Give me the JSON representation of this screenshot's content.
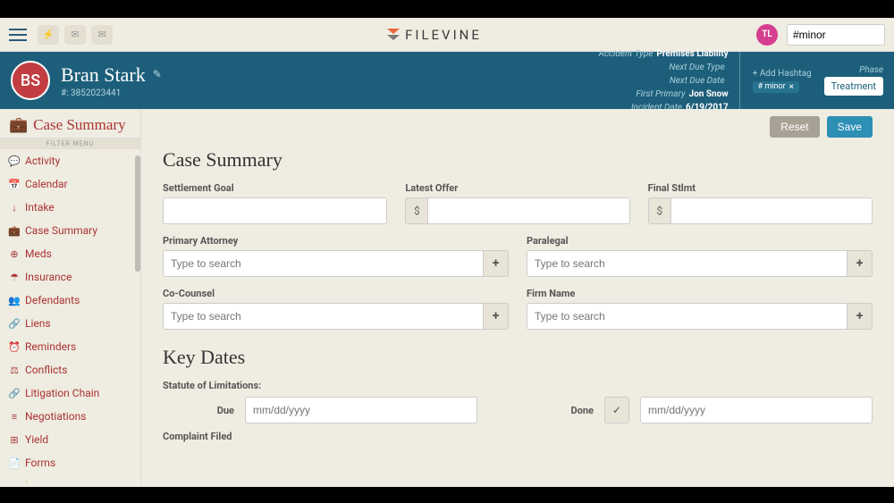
{
  "topbar": {
    "logo_text": "FILEVINE",
    "user_initials": "TL",
    "search_value": "#minor"
  },
  "case_header": {
    "avatar_initials": "BS",
    "name": "Bran Stark",
    "id_label": "#: 3852023441",
    "meta": {
      "accident_type": {
        "label": "Accident Type",
        "value": "Premises Liability"
      },
      "next_due_type": {
        "label": "Next Due Type",
        "value": ""
      },
      "next_due_date": {
        "label": "Next Due Date",
        "value": ""
      },
      "first_primary": {
        "label": "First Primary",
        "value": "Jon Snow"
      },
      "incident_date": {
        "label": "Incident Date",
        "value": "6/19/2017"
      }
    },
    "hashtag": {
      "add_label": "+ Add Hashtag",
      "chip": "# minor"
    },
    "phase": {
      "label": "Phase",
      "value": "Treatment"
    }
  },
  "sidebar": {
    "header": "Case Summary",
    "filter_label": "FILTER MENU",
    "items": [
      {
        "icon": "💬",
        "label": "Activity"
      },
      {
        "icon": "📅",
        "label": "Calendar"
      },
      {
        "icon": "↓",
        "label": "Intake"
      },
      {
        "icon": "💼",
        "label": "Case Summary"
      },
      {
        "icon": "⊕",
        "label": "Meds"
      },
      {
        "icon": "☂",
        "label": "Insurance"
      },
      {
        "icon": "👥",
        "label": "Defendants"
      },
      {
        "icon": "🔗",
        "label": "Liens"
      },
      {
        "icon": "⏰",
        "label": "Reminders"
      },
      {
        "icon": "⚖",
        "label": "Conflicts"
      },
      {
        "icon": "🔗",
        "label": "Litigation Chain"
      },
      {
        "icon": "≡",
        "label": "Negotiations"
      },
      {
        "icon": "⊞",
        "label": "Yield"
      },
      {
        "icon": "📄",
        "label": "Forms"
      },
      {
        "icon": "⚠",
        "label": "Issues"
      }
    ]
  },
  "main": {
    "buttons": {
      "reset": "Reset",
      "save": "Save"
    },
    "section1_title": "Case Summary",
    "settlement_goal": "Settlement Goal",
    "latest_offer": "Latest Offer",
    "final_stlmt": "Final Stlmt",
    "currency": "$",
    "primary_attorney": "Primary Attorney",
    "paralegal": "Paralegal",
    "co_counsel": "Co-Counsel",
    "firm_name": "Firm Name",
    "type_to_search": "Type to search",
    "section2_title": "Key Dates",
    "statute": "Statute of Limitations:",
    "due": "Due",
    "done": "Done",
    "date_placeholder": "mm/dd/yyyy",
    "complaint_filed": "Complaint Filed"
  }
}
